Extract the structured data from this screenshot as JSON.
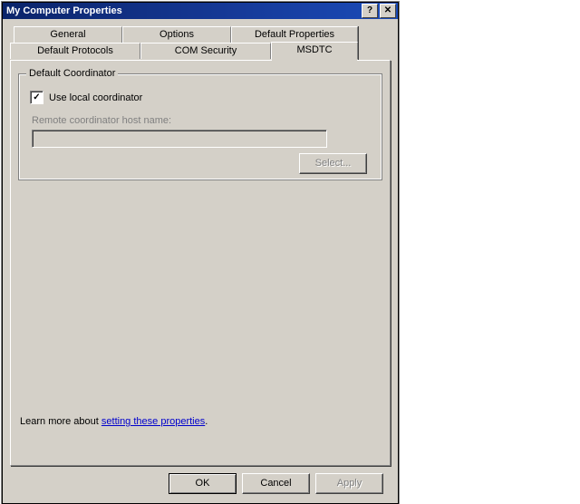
{
  "window": {
    "title": "My Computer Properties"
  },
  "tabs": {
    "general": "General",
    "options": "Options",
    "default_properties": "Default Properties",
    "default_protocols": "Default Protocols",
    "com_security": "COM Security",
    "msdtc": "MSDTC",
    "active": "msdtc"
  },
  "msdtc": {
    "group_title": "Default Coordinator",
    "use_local_label": "Use local coordinator",
    "use_local_checked": true,
    "remote_label": "Remote coordinator host name:",
    "remote_value": "",
    "select_button": "Select...",
    "remote_enabled": false
  },
  "learn_more": {
    "prefix": "Learn more about ",
    "link_text": "setting these properties",
    "suffix": "."
  },
  "buttons": {
    "ok": "OK",
    "cancel": "Cancel",
    "apply": "Apply",
    "apply_enabled": false
  }
}
